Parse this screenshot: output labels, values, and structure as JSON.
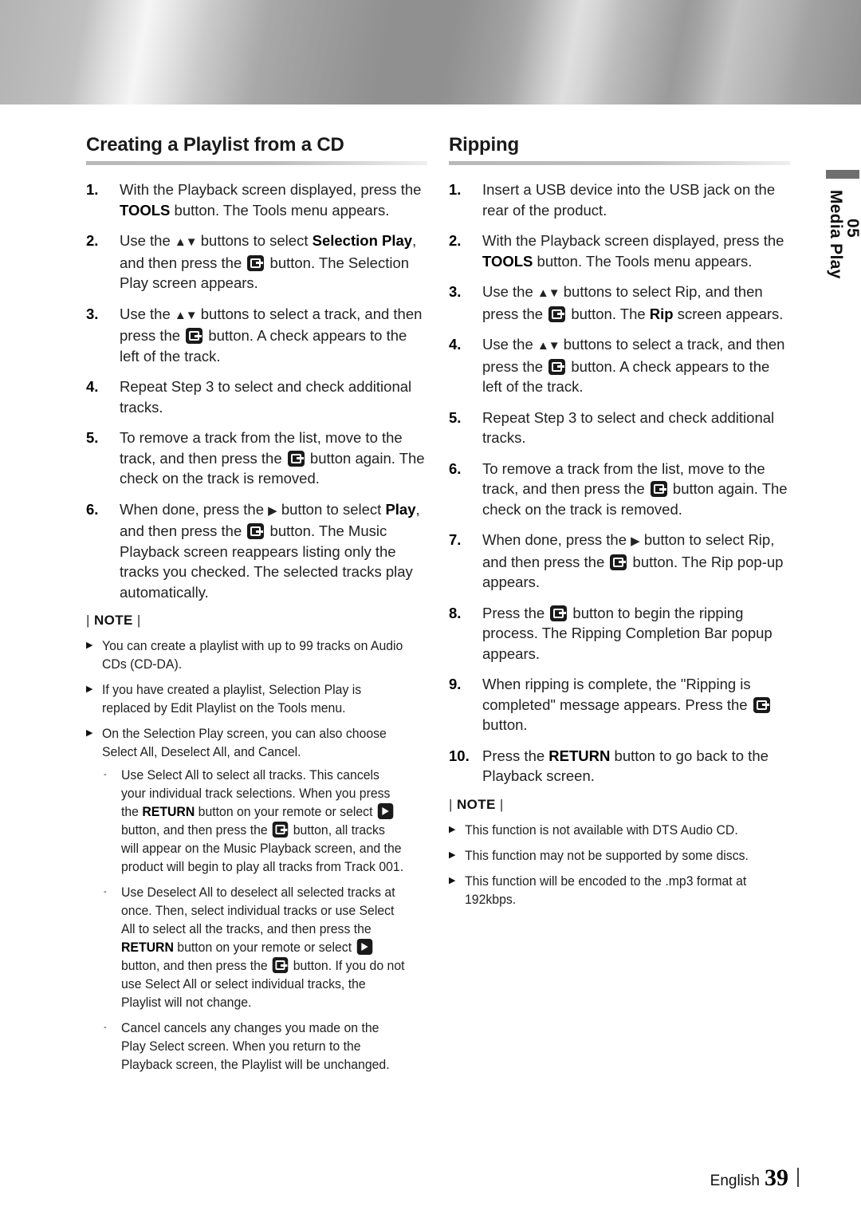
{
  "page": {
    "side_tab": {
      "number": "05",
      "label": "Media Play"
    },
    "footer": {
      "language": "English",
      "page_number": "39"
    }
  },
  "left_column": {
    "title": "Creating a Playlist from a CD",
    "steps": [
      {
        "num": "1.",
        "html": "With the Playback screen displayed, press the <b>TOOLS</b> button. The Tools menu appears."
      },
      {
        "num": "2.",
        "html": "Use the <span class=\"updown\">▲▼</span> buttons to select <b>Selection Play</b>, and then press the <span class=\"kbtn enter\" data-name=\"enter-button-icon\"></span> button. The Selection Play screen appears."
      },
      {
        "num": "3.",
        "html": "Use the <span class=\"updown\">▲▼</span> buttons to select a track, and then press the <span class=\"kbtn enter\" data-name=\"enter-button-icon\"></span> button. A check appears to the left of the track."
      },
      {
        "num": "4.",
        "html": "Repeat Step 3 to select and check additional tracks."
      },
      {
        "num": "5.",
        "html": "To remove a track from the list, move to the track, and then press the <span class=\"kbtn enter\" data-name=\"enter-button-icon\"></span> button again. The check on the track is removed."
      },
      {
        "num": "6.",
        "html": "When done, press the <span class=\"tri-right\">▶</span> button to select <b>Play</b>, and then press the <span class=\"kbtn enter\" data-name=\"enter-button-icon\"></span> button. The Music Playback screen reappears listing only the tracks you checked. The selected tracks play automatically."
      }
    ],
    "note_label": "NOTE",
    "notes": [
      {
        "html": "You can create a playlist with up to 99 tracks on Audio CDs (CD-DA)."
      },
      {
        "html": "If you have created a playlist, Selection Play is replaced by Edit Playlist on the Tools menu."
      },
      {
        "html": "On the Selection Play screen, you can also choose Select All, Deselect All, and Cancel.",
        "sub": [
          {
            "html": "Use Select All to select all tracks. This cancels your individual track selections. When you press the <b>RETURN</b> button on your remote or select <span class=\"kbtn play\" data-name=\"play-button-icon\"></span> button, and then press the <span class=\"kbtn enter\" data-name=\"enter-button-icon\"></span> button, all tracks will appear on the Music Playback screen, and the product will begin to play all tracks from Track 001."
          },
          {
            "html": "Use Deselect All to deselect all selected tracks at once. Then, select individual tracks or use Select All to select all the tracks, and then press the <b>RETURN</b> button on your remote or select <span class=\"kbtn play\" data-name=\"play-button-icon\"></span> button, and then press the <span class=\"kbtn enter\" data-name=\"enter-button-icon\"></span> button. If you do not use Select All or select individual tracks, the Playlist will not change."
          },
          {
            "html": "Cancel cancels any changes you made on the Play Select screen. When you return to the Playback screen, the Playlist will be unchanged."
          }
        ]
      }
    ]
  },
  "right_column": {
    "title": "Ripping",
    "steps": [
      {
        "num": "1.",
        "html": "Insert a USB device into the USB jack on the rear of the product."
      },
      {
        "num": "2.",
        "html": "With the Playback screen displayed, press the <b>TOOLS</b> button. The Tools menu appears."
      },
      {
        "num": "3.",
        "html": "Use the <span class=\"updown\">▲▼</span> buttons to select Rip, and then press the <span class=\"kbtn enter\" data-name=\"enter-button-icon\"></span> button. The <b>Rip</b> screen appears."
      },
      {
        "num": "4.",
        "html": "Use the <span class=\"updown\">▲▼</span> buttons to select a track, and then press the <span class=\"kbtn enter\" data-name=\"enter-button-icon\"></span> button. A check appears to the left of the track."
      },
      {
        "num": "5.",
        "html": "Repeat Step 3 to select and check additional tracks."
      },
      {
        "num": "6.",
        "html": "To remove a track from the list, move to the track, and then press the <span class=\"kbtn enter\" data-name=\"enter-button-icon\"></span> button again. The check on the track is removed."
      },
      {
        "num": "7.",
        "html": "When done, press the <span class=\"tri-right\">▶</span> button to select Rip, and then press the <span class=\"kbtn enter\" data-name=\"enter-button-icon\"></span> button. The Rip pop-up appears."
      },
      {
        "num": "8.",
        "html": "Press the <span class=\"kbtn enter\" data-name=\"enter-button-icon\"></span> button to begin the ripping process. The Ripping Completion Bar popup appears."
      },
      {
        "num": "9.",
        "html": "When ripping is complete, the \"Ripping is completed\" message appears. Press the <span class=\"kbtn enter\" data-name=\"enter-button-icon\"></span> button."
      },
      {
        "num": "10.",
        "html": "Press the <b>RETURN</b> button to go back to the Playback screen."
      }
    ],
    "note_label": "NOTE",
    "notes": [
      {
        "html": "This function is not available with DTS Audio CD."
      },
      {
        "html": "This function may not be supported by some discs."
      },
      {
        "html": "This function will be encoded to the .mp3 format at 192kbps."
      }
    ]
  }
}
